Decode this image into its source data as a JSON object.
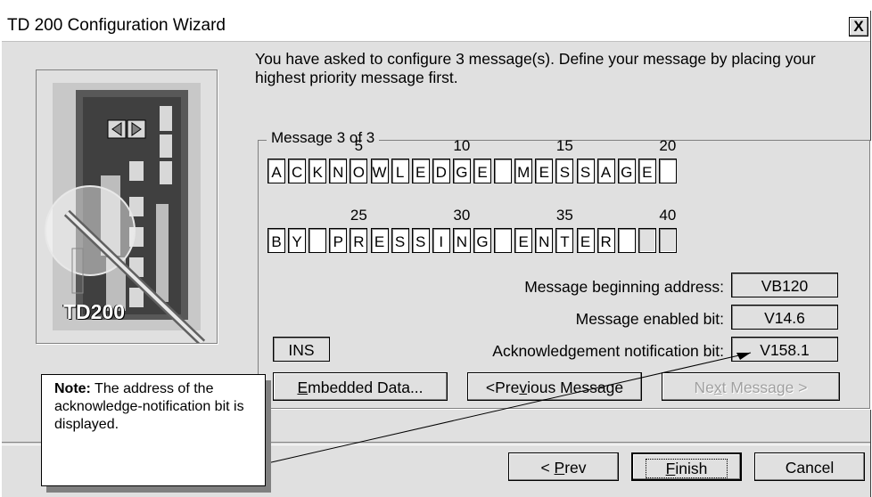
{
  "window": {
    "title": "TD 200 Configuration Wizard",
    "close_label": "X"
  },
  "image": {
    "label": "TD200"
  },
  "intro_text": "You have asked to configure 3 message(s). Define your message by placing your highest priority message first.",
  "group_label": "Message 3 of 3",
  "row1": {
    "numbers": [
      "5",
      "10",
      "15",
      "20"
    ],
    "cells": [
      "A",
      "C",
      "K",
      "N",
      "O",
      "W",
      "L",
      "E",
      "D",
      "G",
      "E",
      "",
      "M",
      "E",
      "S",
      "S",
      "A",
      "G",
      "E",
      ""
    ]
  },
  "row2": {
    "numbers": [
      "25",
      "30",
      "35",
      "40"
    ],
    "cells": [
      "B",
      "Y",
      "",
      "P",
      "R",
      "E",
      "S",
      "S",
      "I",
      "N",
      "G",
      "",
      "E",
      "N",
      "T",
      "E",
      "R",
      "",
      "",
      ""
    ]
  },
  "fields": {
    "beginning_address_label": "Message beginning address:",
    "beginning_address_value": "VB120",
    "enabled_bit_label": "Message enabled bit:",
    "enabled_bit_value": "V14.6",
    "ack_bit_label": "Acknowledgement notification bit:",
    "ack_bit_value": "V158.1",
    "ins_label": "INS"
  },
  "buttons": {
    "embedded_data": "Embedded Data...",
    "previous_message": "<Previous Message",
    "next_message": "Next Message >",
    "prev": "< Prev",
    "finish": "Finish",
    "cancel": "Cancel"
  },
  "note": {
    "bold": "Note:",
    "text": " The address of the acknowledge-notification bit is displayed."
  }
}
